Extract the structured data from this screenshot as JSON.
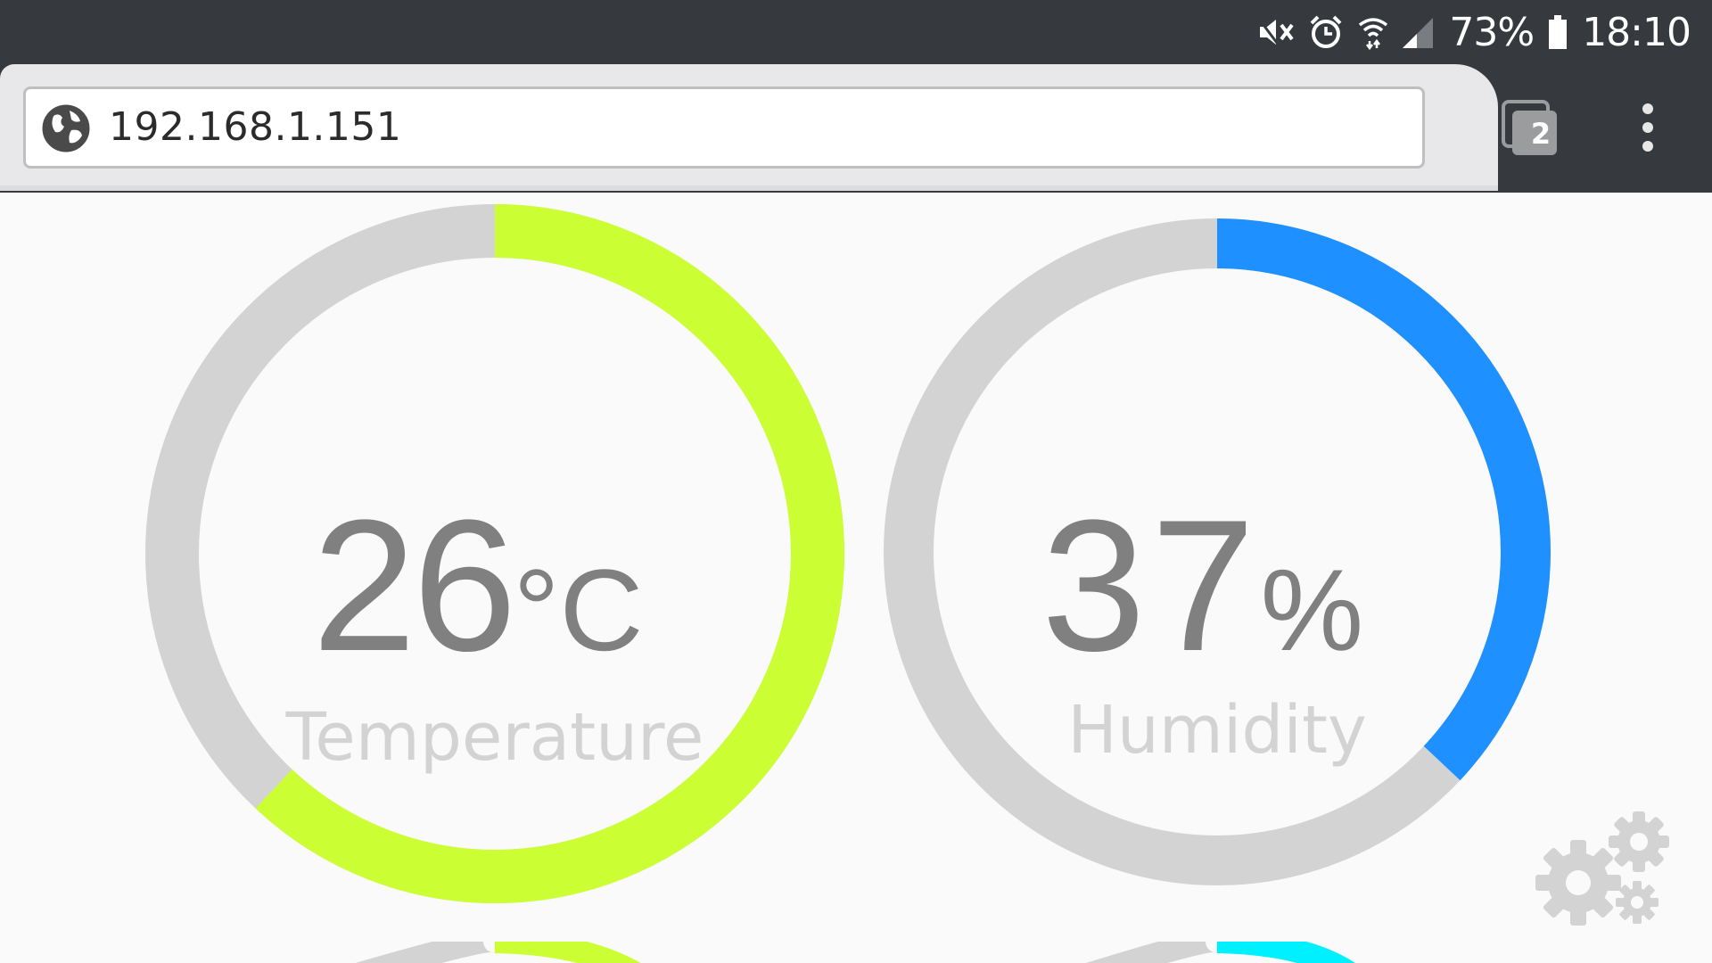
{
  "status_bar": {
    "battery": "73%",
    "time": "18:10",
    "icons": [
      "mute-icon",
      "alarm-icon",
      "wifi-icon",
      "signal-icon",
      "battery-icon"
    ]
  },
  "browser": {
    "url": "192.168.1.151",
    "tab_count": "2",
    "icons": [
      "globe-icon",
      "tabs-icon",
      "menu-icon"
    ]
  },
  "gauges": [
    {
      "label": "Temperature",
      "value": "26",
      "unit": "°C",
      "fraction": 0.62,
      "color": "#ccff33"
    },
    {
      "label": "Humidity",
      "value": "37",
      "unit": "%",
      "fraction": 0.37,
      "color": "#1e90ff"
    }
  ],
  "partial_gauges": [
    {
      "color": "#ccff33"
    },
    {
      "color": "#00f0ff"
    }
  ],
  "settings_icon": "gears-icon",
  "colors": {
    "status_bar_bg": "#363a3e",
    "toolbar_bg": "#e8e8ea",
    "track": "#d3d3d3",
    "value_text": "#808080",
    "label_text": "#d3d3d3"
  }
}
